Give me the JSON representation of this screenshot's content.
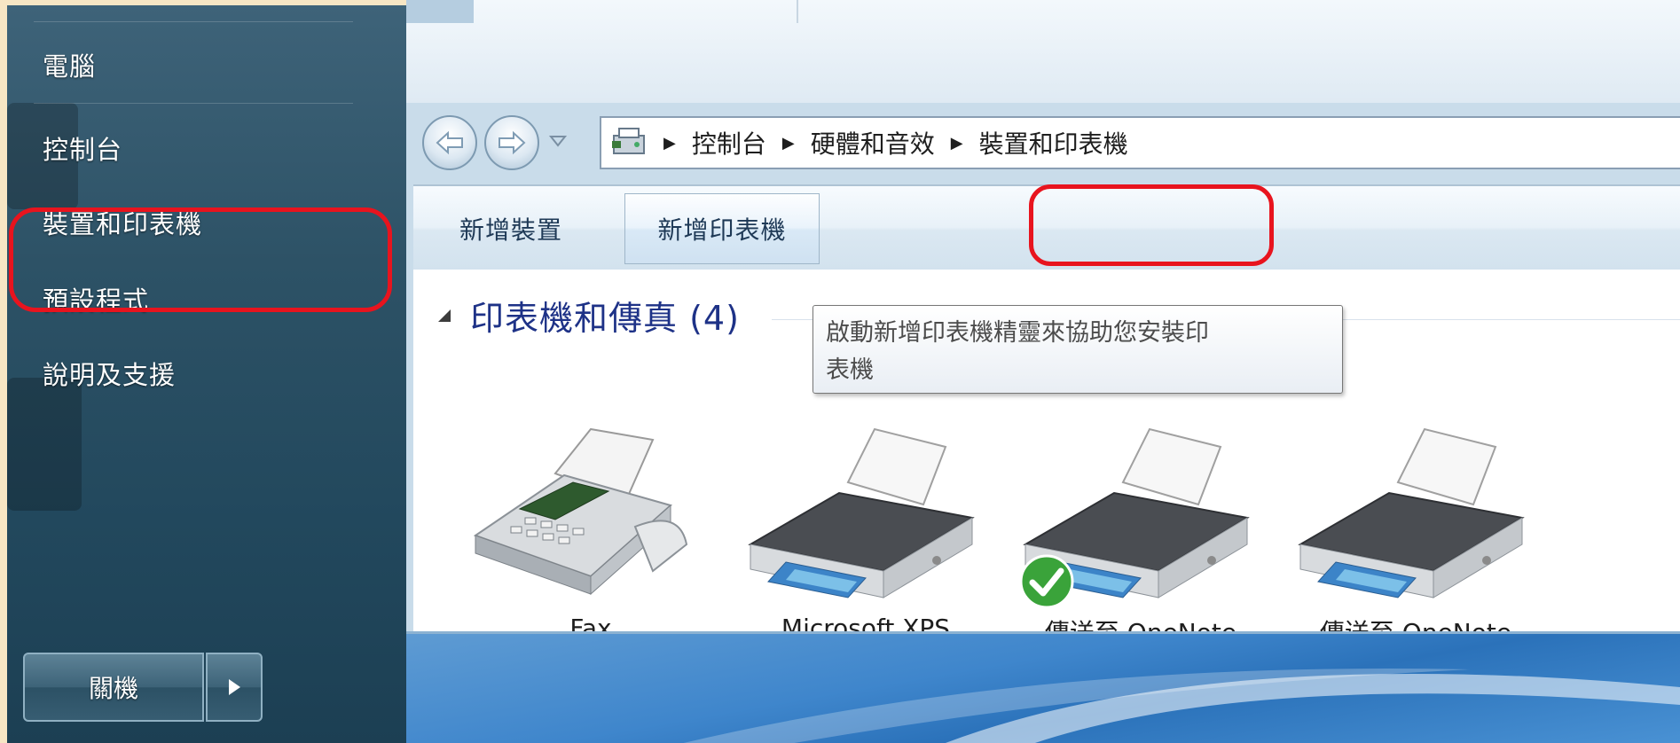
{
  "start_menu": {
    "items": [
      {
        "label": "電腦"
      },
      {
        "label": "控制台"
      },
      {
        "label": "裝置和印表機"
      },
      {
        "label": "預設程式"
      },
      {
        "label": "說明及支援"
      }
    ],
    "shutdown_label": "關機"
  },
  "explorer": {
    "breadcrumb": [
      "控制台",
      "硬體和音效",
      "裝置和印表機"
    ],
    "toolbar": {
      "add_device_label": "新增裝置",
      "add_printer_label": "新增印表機"
    },
    "group": {
      "title": "印表機和傳真 (4)"
    },
    "tooltip": {
      "text_line1": "啟動新增印表機精靈來協助您安裝印",
      "text_line2": "表機"
    },
    "devices": [
      {
        "label": "Fax",
        "icon": "fax-icon"
      },
      {
        "label": "Microsoft XPS",
        "icon": "printer-icon"
      },
      {
        "label": "傳送至 OneNote",
        "icon": "printer-icon",
        "default": true
      },
      {
        "label": "傳送至 OneNote",
        "icon": "printer-icon"
      }
    ]
  },
  "colors": {
    "annotation_red": "#e8141e",
    "group_title": "#1e3287",
    "default_check": "#3aa33a"
  }
}
